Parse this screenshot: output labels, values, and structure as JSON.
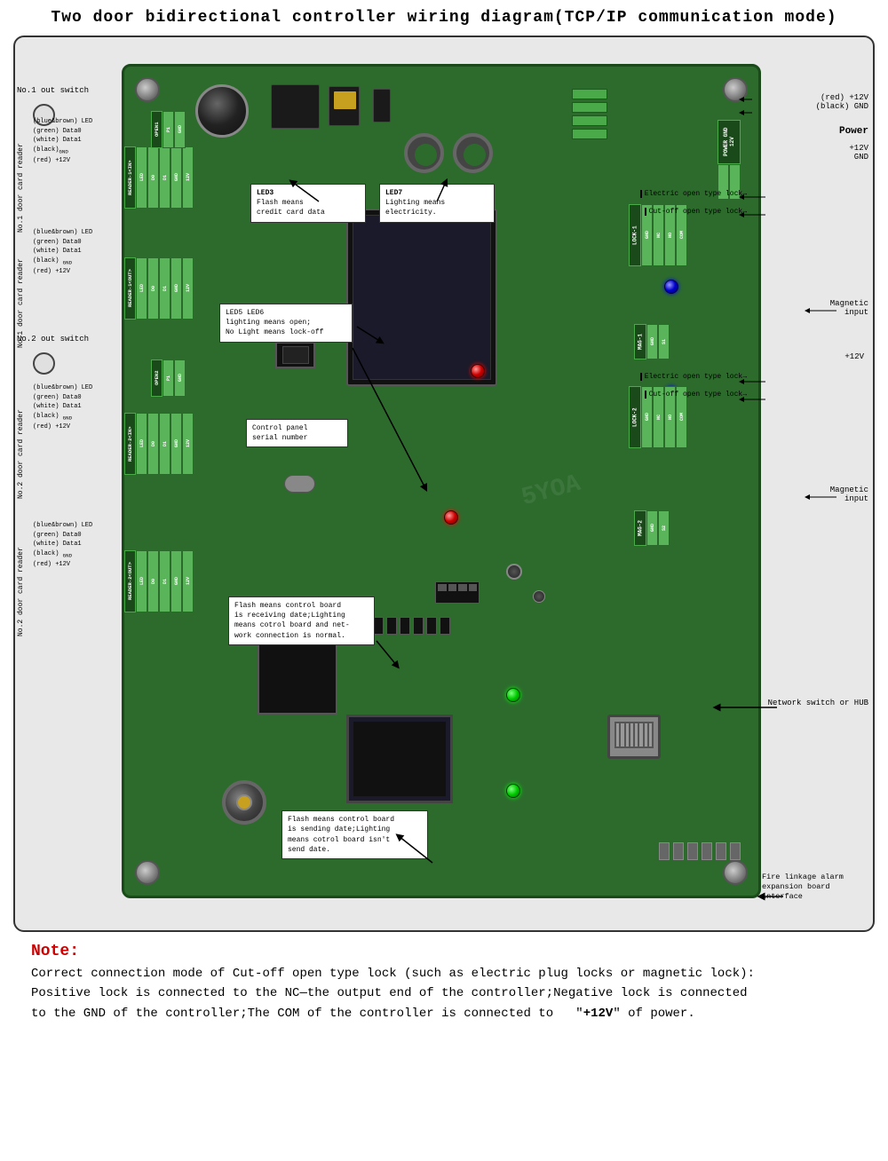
{
  "title": "Two door bidirectional controller wiring diagram(TCP/IP communication mode)",
  "diagram": {
    "left_labels": {
      "no1_out_switch": "No.1 out switch",
      "no1_door_card_reader": "No.1 door card reader",
      "no2_door_card_reader_top": "No.2 door card reader",
      "no2_out_switch": "No.2 out switch",
      "no2_door_card_reader_bot": "No.2 door card reader",
      "no2_door_card_reader_bot2": "No.2 door card reader"
    },
    "reader1_in_pins": [
      "LED",
      "D0",
      "D1",
      "GND",
      "12V"
    ],
    "reader1_out_pins": [
      "LED",
      "D0",
      "D1",
      "GND",
      "12V"
    ],
    "reader2_in_pins": [
      "LED",
      "D0",
      "D1",
      "GND",
      "12V"
    ],
    "reader2_out_pins": [
      "LED",
      "D0",
      "D1",
      "GND",
      "12V"
    ],
    "open1_pins": [
      "P1",
      "GND",
      "OPEN1"
    ],
    "open2_pins": [
      "P1",
      "GND",
      "OPEN2"
    ],
    "wire_colors_1": [
      "(blue&brown) LED",
      "(green) Data0",
      "(white) Data1",
      "(black) GND",
      "(red) +12V"
    ],
    "wire_colors_2": [
      "(blue&brown) LED",
      "(green) Data0",
      "(white) Data1",
      "(black) GND",
      "(red) +12V"
    ],
    "wire_colors_3": [
      "(blue&brown) LED",
      "(green) Data0",
      "(white) Data1",
      "(black) GND",
      "(red) +12V"
    ],
    "wire_colors_4": [
      "(blue&brown) LED",
      "(green) Data0",
      "(white) Data1",
      "(black) GND",
      "(red) +12V"
    ],
    "right_labels": {
      "power_red": "(red)  +12V",
      "power_black": "(black) GND",
      "power_label": "Power",
      "power_plus": "+12V",
      "power_gnd": "GND",
      "lock1_label": "LOCK-1",
      "lock1_pins": [
        "COM",
        "NO",
        "NC",
        "GND"
      ],
      "electric_open_lock1": "Electric open type lock→",
      "cutoff_open_lock1": "Cut-off open type lock→",
      "mag1_label": "MAG-1",
      "mag1_pins": [
        "GND",
        "S1"
      ],
      "mag1_input": "Magnetic input",
      "lock2_label": "LOCK-2",
      "lock2_plus12v": "+12V",
      "lock2_pins": [
        "COM",
        "NO",
        "NC",
        "GND"
      ],
      "electric_open_lock2": "Electric open type lock→",
      "cutoff_open_lock2": "Cut-off open type lock→",
      "mag2_label": "MAG-2",
      "mag2_pins": [
        "GND",
        "S2"
      ],
      "mag2_input": "Magnetic input",
      "network_switch": "Network switch or HUB",
      "fire_alarm": "Fire linkage alarm\nexpansion board interface"
    },
    "callouts": {
      "led3_label": "LED3",
      "led7_label": "LED7",
      "led3_desc": "LED3\nFlash means\ncredit card data",
      "led7_desc": "LED7\nLighting means\nelectricity.",
      "led5_label": "LED5",
      "led56_desc": "LED5 LED6\nlighting means open;\nNo Light means lock-off",
      "led6_label": "LED6",
      "control_panel": "Control panel\nserial number",
      "flash_receive": "Flash means control board\nis receiving date;Lighting\nmeans cotrol board and net-\nwork connection is normal.",
      "flash_send": "Flash means control board\nis sending date;Lighting\nmeans cotrol board isn't\nsend date.",
      "power_conn_pins": [
        "GND",
        "12V"
      ]
    }
  },
  "note": {
    "title": "Note:",
    "text": "Correct connection mode of Cut-off open type lock (such as electric plug locks or magnetic lock):\nPositive lock is connected to the NC—the output end of the controller;Negative lock is connected\nto the GND of the controller;The COM of the controller is connected to  \"+12V\" of power."
  }
}
